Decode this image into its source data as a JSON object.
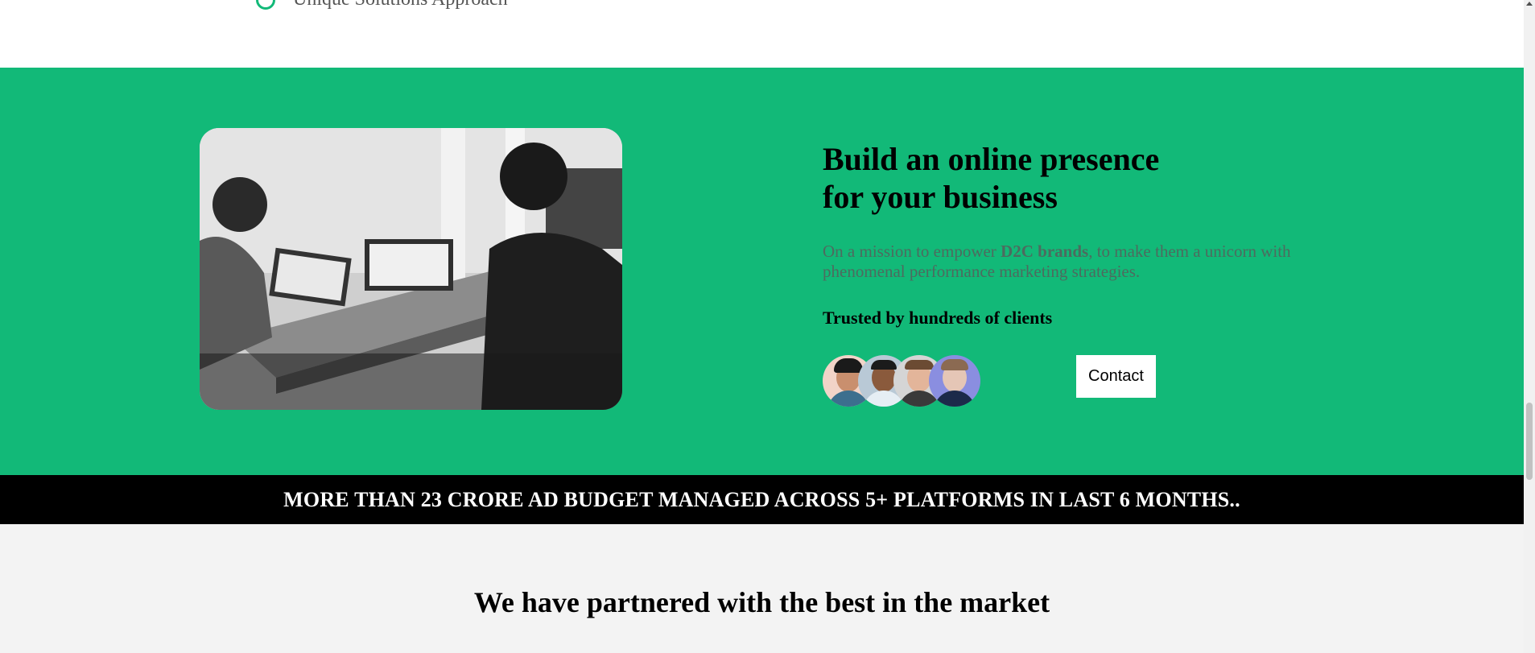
{
  "top_list": {
    "item_label": "Unique Solutions Approach"
  },
  "hero": {
    "title_line1": "Build an online presence",
    "title_line2": "for your business",
    "desc_prefix": "On a mission to empower ",
    "desc_bold": "D2C brands",
    "desc_suffix": ", to make them a unicorn with phenomenal performance marketing strategies.",
    "trusted_label": "Trusted by hundreds of clients",
    "contact_label": "Contact",
    "image_alt": "people-working-at-laptops-photo"
  },
  "banner": {
    "text": "MORE THAN 23 CRORE AD BUDGET MANAGED ACROSS 5+ PLATFORMS IN LAST 6 MONTHS.."
  },
  "partners": {
    "title": "We have partnered with the best in the market"
  },
  "colors": {
    "brand_green": "#12b978",
    "banner_black": "#000000",
    "partners_bg": "#f3f3f3"
  }
}
